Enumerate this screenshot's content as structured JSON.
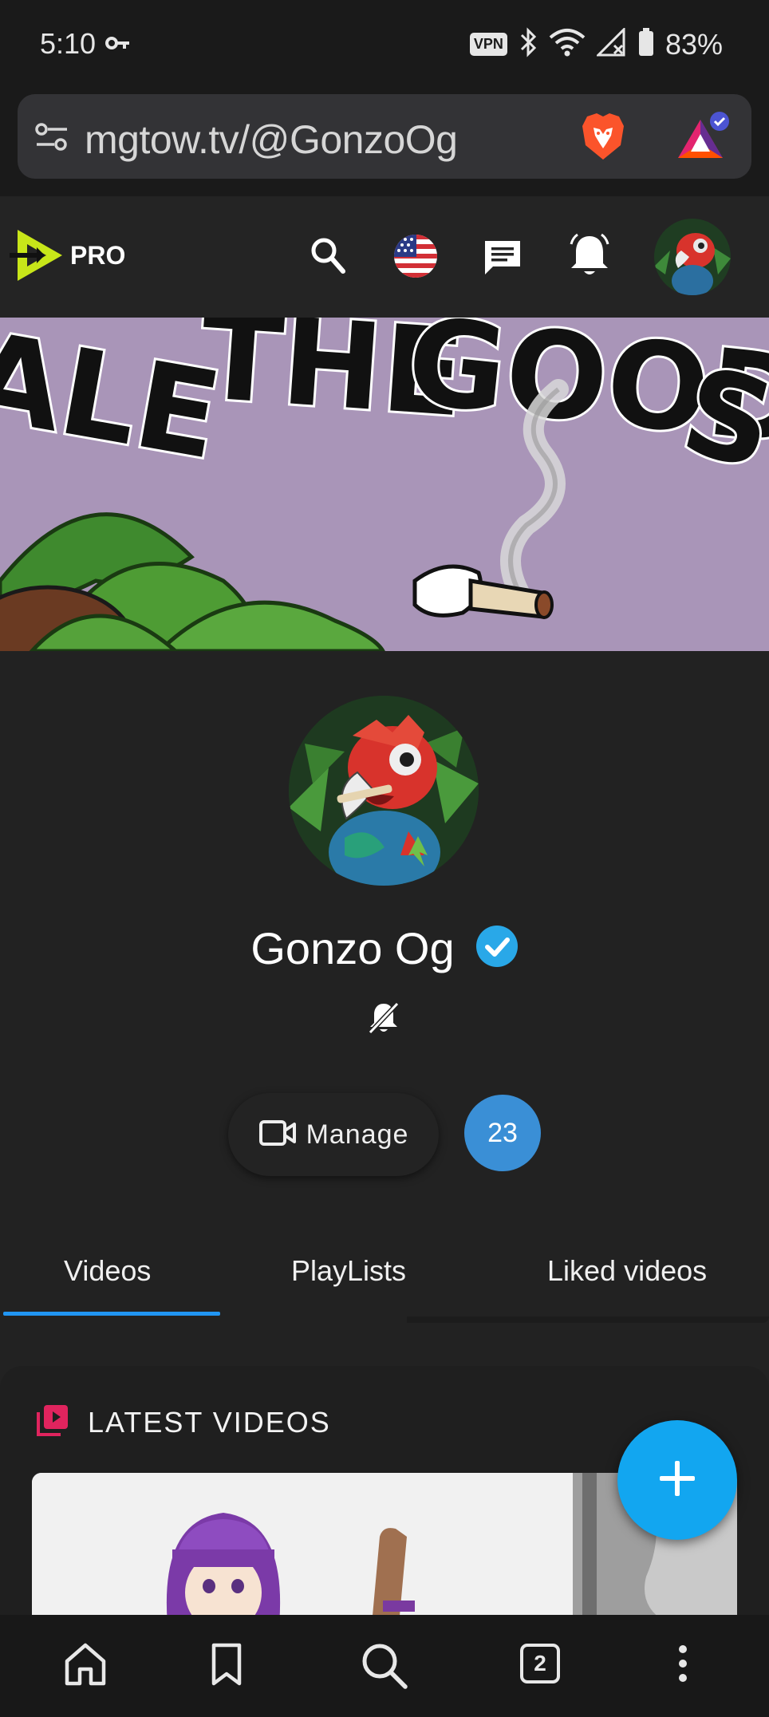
{
  "status_bar": {
    "time": "5:10",
    "vpn_label": "VPN",
    "battery": "83%"
  },
  "browser": {
    "url": "mgtow.tv/@GonzoOg",
    "tab_count": "2"
  },
  "site_header": {
    "logo_text": "PRO",
    "icons": [
      "search-icon",
      "us-flag-icon",
      "messages-icon",
      "notifications-icon",
      "user-avatar"
    ]
  },
  "channel": {
    "name": "Gonzo Og",
    "verified": true,
    "manage_label": "Manage",
    "subscriber_count": "23"
  },
  "tabs": [
    {
      "label": "Videos",
      "active": true
    },
    {
      "label": "PlayLists",
      "active": false
    },
    {
      "label": "Liked videos",
      "active": false
    }
  ],
  "latest_videos": {
    "title": "LATEST VIDEOS"
  },
  "colors": {
    "accent_blue": "#2196f3",
    "fab_blue": "#12a6f0",
    "sub_badge": "#3a8fd6",
    "verified": "#29a8e8",
    "latest_icon": "#e0245e",
    "logo_yellow": "#c8e619"
  }
}
